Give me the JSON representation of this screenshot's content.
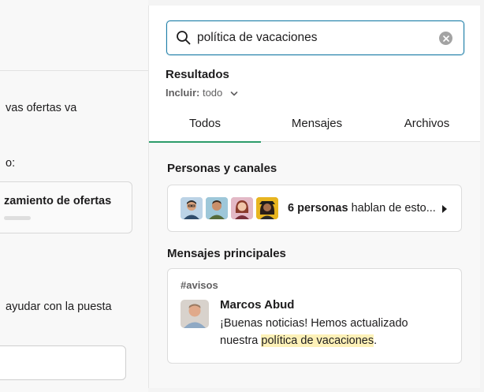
{
  "left_panel": {
    "line1": "vas ofertas va",
    "line2": "o:",
    "card_title": "zamiento de ofertas",
    "line3": "ayudar con la puesta"
  },
  "search": {
    "value": "política de vacaciones",
    "results_title": "Resultados",
    "include_label": "Incluir:",
    "include_value": "todo"
  },
  "tabs": [
    {
      "label": "Todos",
      "active": true
    },
    {
      "label": "Mensajes",
      "active": false
    },
    {
      "label": "Archivos",
      "active": false
    }
  ],
  "people_section": {
    "title": "Personas y canales",
    "count_bold": "6 personas",
    "rest": " hablan de esto..."
  },
  "messages_section": {
    "title": "Mensajes principales",
    "channel": "#avisos",
    "author": "Marcos Abud",
    "line1": "¡Buenas noticias! Hemos actualizado",
    "line2_prefix": "nuestra ",
    "line2_highlight": "política de vacaciones",
    "line2_suffix": "."
  },
  "colors": {
    "accent_border": "#1e7ea8",
    "active_tab": "#2d9c6a",
    "highlight": "#fdf1b8"
  },
  "icons": [
    "search-icon",
    "clear-icon",
    "chevron-down-icon",
    "play-icon"
  ]
}
